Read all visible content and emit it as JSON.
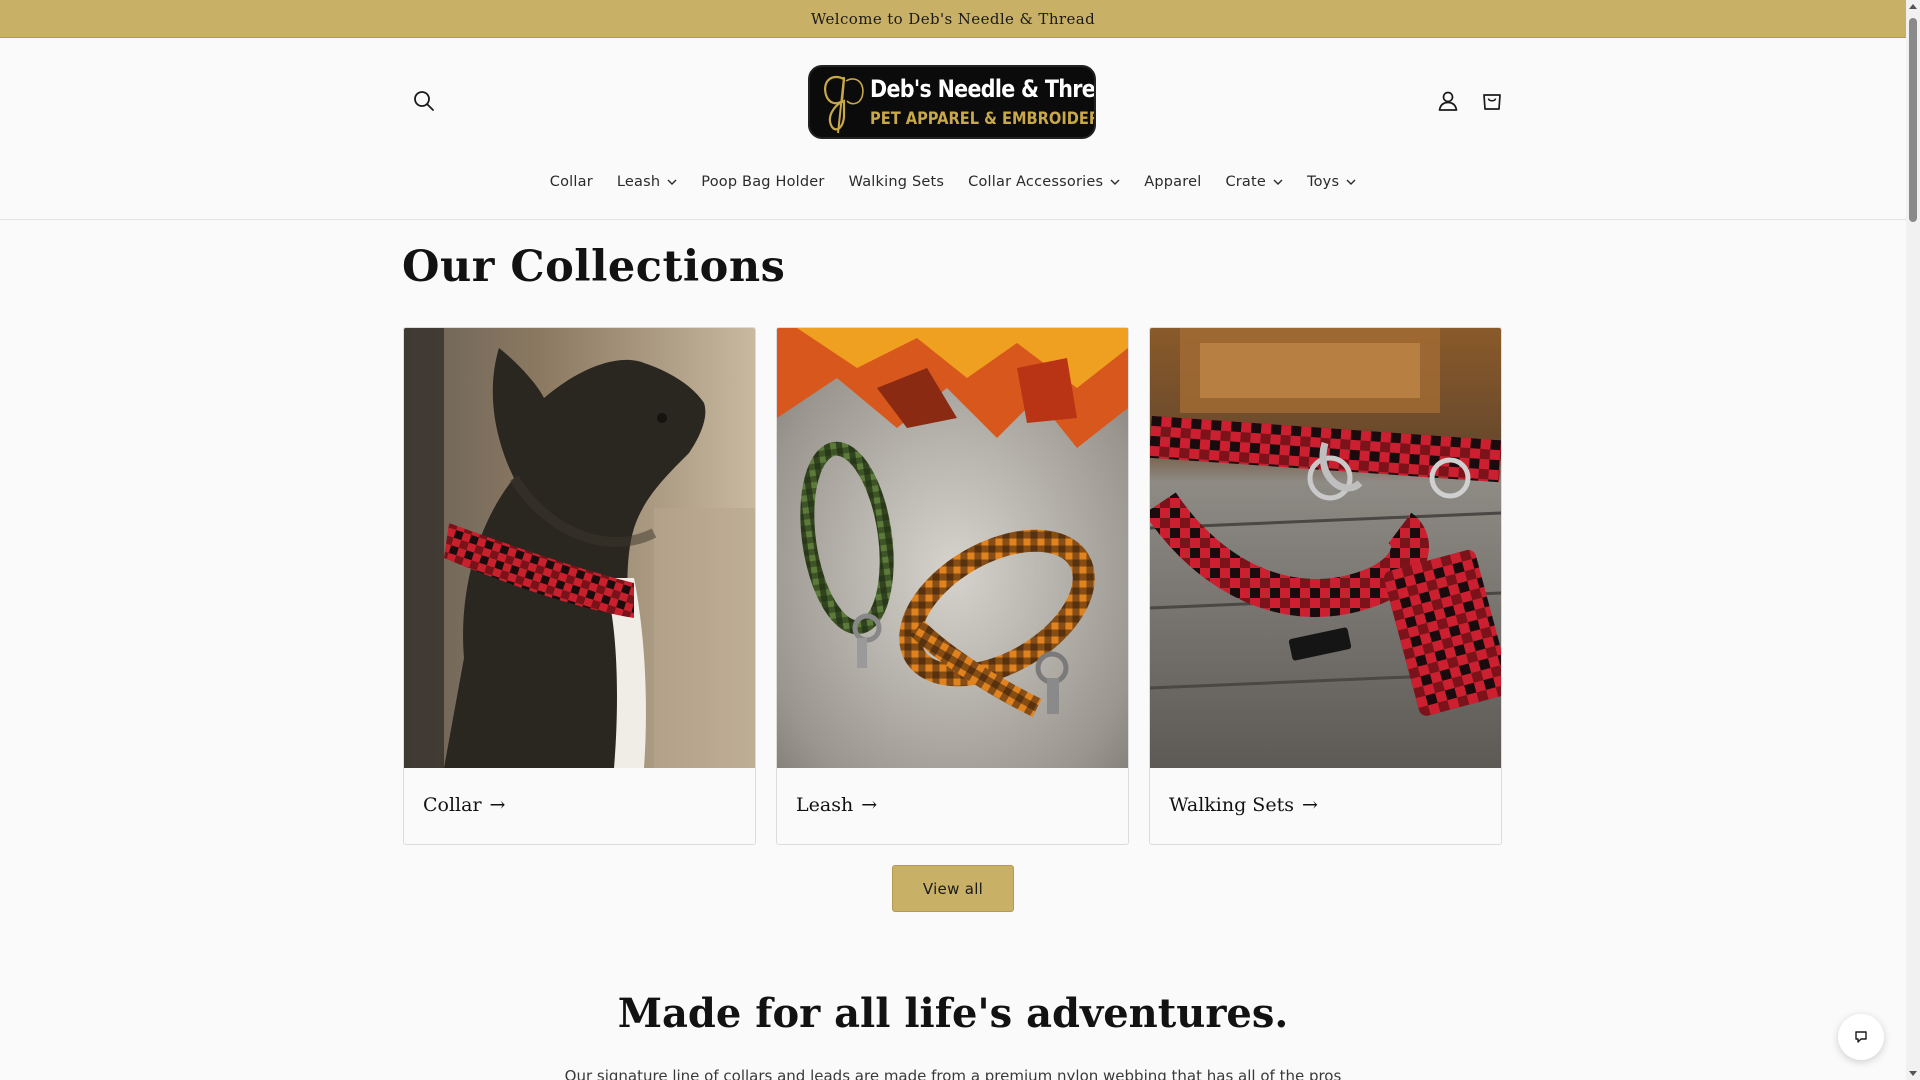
{
  "announcement": {
    "text": "Welcome to Deb's Needle & Thread"
  },
  "header": {
    "logo": {
      "line1": "Deb's Needle & Thread",
      "line2": "PET APPAREL & EMBROIDERY"
    },
    "icons": {
      "search": "search-icon",
      "account": "user-icon",
      "cart": "cart-icon"
    }
  },
  "nav": {
    "items": [
      {
        "label": "Collar",
        "dropdown": false
      },
      {
        "label": "Leash",
        "dropdown": true
      },
      {
        "label": "Poop Bag Holder",
        "dropdown": false
      },
      {
        "label": "Walking Sets",
        "dropdown": false
      },
      {
        "label": "Collar Accessories",
        "dropdown": true
      },
      {
        "label": "Apparel",
        "dropdown": false
      },
      {
        "label": "Crate",
        "dropdown": true
      },
      {
        "label": "Toys",
        "dropdown": true
      }
    ]
  },
  "collections": {
    "title": "Our Collections",
    "cards": [
      {
        "label": "Collar",
        "arrow": "→"
      },
      {
        "label": "Leash",
        "arrow": "→"
      },
      {
        "label": "Walking Sets",
        "arrow": "→"
      }
    ],
    "view_all": "View all"
  },
  "promo": {
    "title": "Made for all life's adventures.",
    "text": "Our signature line of collars and leads are made from a premium nylon webbing that has all of the pros"
  },
  "colors": {
    "accent": "#c9b067",
    "background": "#fafafa",
    "text": "#121212",
    "logo_gold": "#c9a84a"
  }
}
